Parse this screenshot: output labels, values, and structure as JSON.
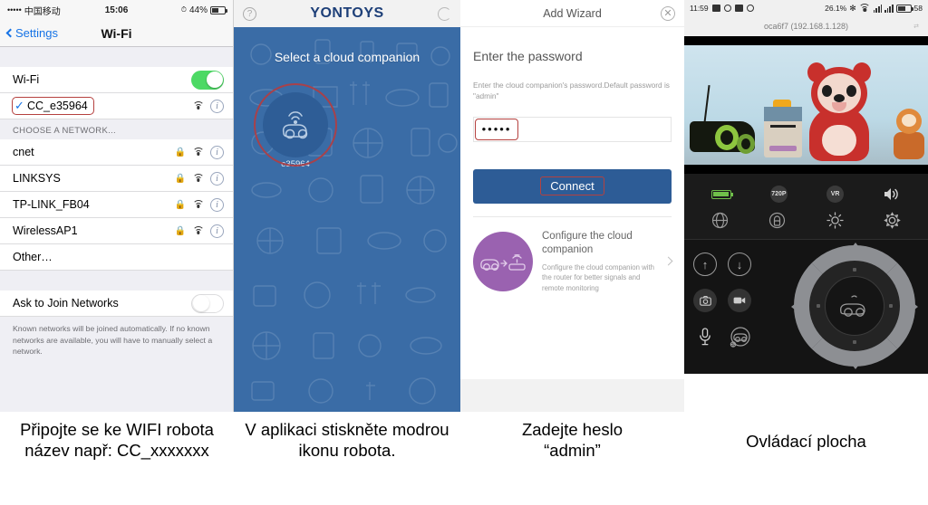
{
  "panel1": {
    "name": "ios-wifi-settings",
    "status": {
      "signal_dots": "•••••",
      "carrier": "中国移动",
      "time": "15:06",
      "battery_pct": "44%"
    },
    "nav": {
      "back_label": "Settings",
      "title": "Wi-Fi"
    },
    "wifi_row": {
      "label": "Wi-Fi",
      "toggle_state": "on"
    },
    "connected_network": {
      "name": "CC_e35964",
      "checked": true,
      "highlighted": true
    },
    "section_header": "CHOOSE A NETWORK...",
    "networks": [
      {
        "name": "cnet",
        "locked": true
      },
      {
        "name": "LINKSYS",
        "locked": true
      },
      {
        "name": "TP-LINK_FB04",
        "locked": true
      },
      {
        "name": "WirelessAP1",
        "locked": true
      }
    ],
    "other_label": "Other…",
    "ask_to_join": {
      "label": "Ask to Join Networks",
      "toggle_state": "off"
    },
    "footer_note": "Known networks will be joined automatically. If no known networks are available, you will have to manually select a network."
  },
  "panel2": {
    "name": "yontoys-app",
    "help_icon": "?",
    "logo": "YONTOYS",
    "refresh_icon": "↻",
    "heading": "Select a cloud companion",
    "companion": {
      "id": "e35964",
      "highlighted": true
    }
  },
  "panel3": {
    "name": "add-wizard",
    "title": "Add Wizard",
    "close_icon": "✕",
    "heading": "Enter the password",
    "description": "Enter the cloud companion's password.Default password is \"admin\"",
    "password_field": {
      "value": "•••••",
      "masked_chars": 5,
      "highlighted": true
    },
    "connect_button": "Connect",
    "configure": {
      "title": "Configure the cloud companion",
      "description": "Configure the cloud companion with the router for better signals and remote monitoring",
      "chevron": "›"
    }
  },
  "panel4": {
    "name": "robot-control-panel",
    "status": {
      "time": "11:59",
      "cpu": "26.1%",
      "battery_pct": "58"
    },
    "device_label": "oca6f7 (192.168.1.128)",
    "icons_row1": [
      {
        "name": "battery-indicator",
        "label": ""
      },
      {
        "name": "resolution-720p",
        "label": "720P"
      },
      {
        "name": "vr-mode",
        "label": "VR"
      },
      {
        "name": "volume-speaker",
        "label": ""
      }
    ],
    "icons_row2": [
      {
        "name": "fisheye-view",
        "label": ""
      },
      {
        "name": "rotate-lock",
        "label": ""
      },
      {
        "name": "brightness",
        "label": ""
      },
      {
        "name": "settings-gear",
        "label": ""
      }
    ],
    "controls": [
      {
        "name": "arrow-up-button",
        "glyph": "↑"
      },
      {
        "name": "arrow-down-button",
        "glyph": "↓"
      },
      {
        "name": "snapshot-button",
        "glyph": "▣"
      },
      {
        "name": "record-button",
        "glyph": "▶"
      },
      {
        "name": "microphone-button",
        "glyph": "⬤"
      },
      {
        "name": "robot-settings-button",
        "glyph": "⬤"
      }
    ]
  },
  "captions": [
    "Připojte se ke WIFI robota název např: CC_xxxxxxx",
    "V aplikaci stiskněte modrou ikonu robota.",
    "Zadejte heslo\n“admin”",
    "Ovládací plocha"
  ],
  "caption_lines": {
    "c1a": "Připojte se ke WIFI robota",
    "c1b": "název např: CC_xxxxxxx",
    "c2a": "V aplikaci stiskněte modrou",
    "c2b": "ikonu robota.",
    "c3a": "Zadejte heslo",
    "c3b": "“admin”",
    "c4a": "Ovládací plocha"
  },
  "colors": {
    "ios_blue": "#1673e6",
    "ios_green": "#4cd964",
    "app_blue": "#3a6ca6",
    "connect_blue": "#2d5c96",
    "purple": "#9a62b0",
    "highlight_red": "#b5413f"
  }
}
